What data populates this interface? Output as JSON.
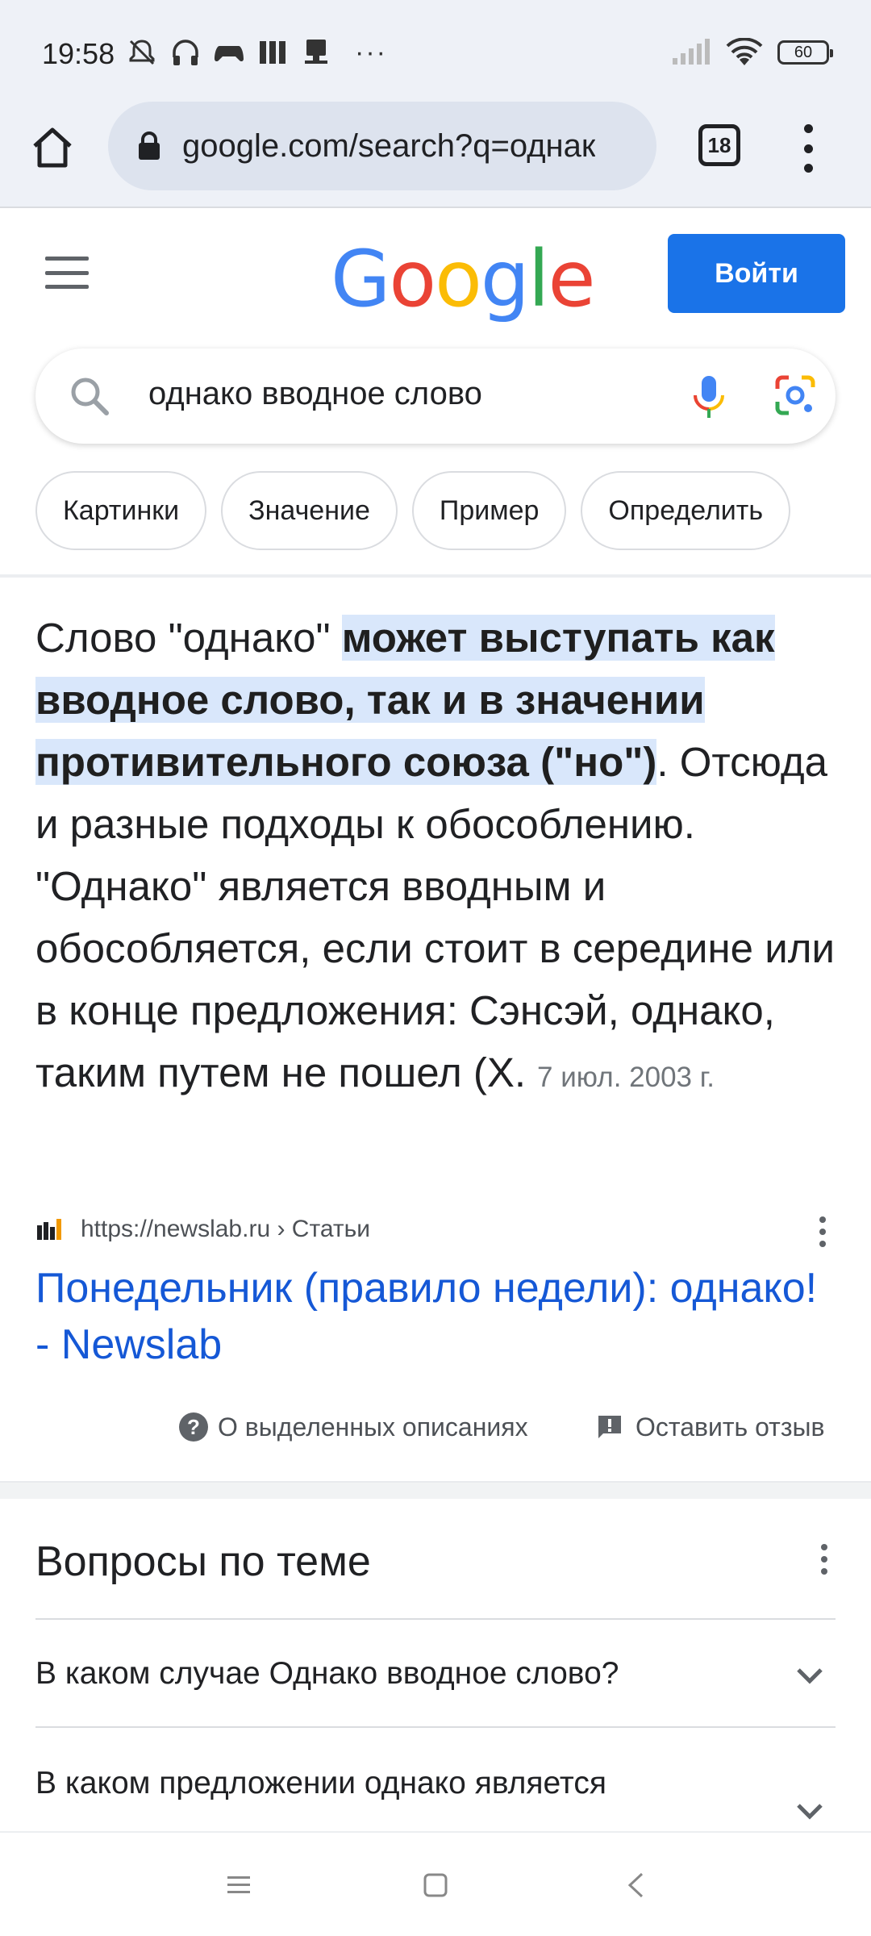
{
  "status_bar": {
    "time": "19:58",
    "battery_level": "60",
    "icons": [
      "mute-icon",
      "headphones-icon",
      "gamepad-icon",
      "app-icon",
      "stamp-icon",
      "more-icon",
      "signal-icon",
      "wifi-icon",
      "battery-icon"
    ],
    "more_indicator": "···"
  },
  "browser": {
    "url": "google.com/search?q=однак",
    "tab_count": "18"
  },
  "header": {
    "logo_letters": [
      "G",
      "o",
      "o",
      "g",
      "l",
      "e"
    ],
    "logo_colors": [
      "#4285F4",
      "#EA4335",
      "#FBBC05",
      "#4285F4",
      "#34A853",
      "#EA4335"
    ],
    "signin_label": "Войти"
  },
  "search": {
    "query": "однако вводное слово"
  },
  "chips": [
    "Картинки",
    "Значение",
    "Пример",
    "Определить"
  ],
  "snippet": {
    "lead": "Слово \"однако\" ",
    "highlight": "может выступать как вводное слово, так и в значении противительного союза (\"но\")",
    "rest": ". Отсюда и разные подходы к обособлению. \"Однако\" является вводным и обособляется, если стоит в середине или в конце предложения: Сэнсэй, однако, таким путем не пошел (Х.",
    "date": "7 июл. 2003 г.",
    "source": "https://newslab.ru › Статьи",
    "title": "Понедельник (правило недели): однако! - Newslab"
  },
  "snippet_footer": {
    "about_label": "О выделенных описаниях",
    "feedback_label": "Оставить отзыв"
  },
  "faq": {
    "title": "Вопросы по теме",
    "questions": [
      "В каком случае Однако вводное слово?",
      "В каком предложении однако является"
    ]
  },
  "colors": {
    "accent": "#1a73e8",
    "link": "#1558d6",
    "highlight": "#d9e7fb"
  }
}
